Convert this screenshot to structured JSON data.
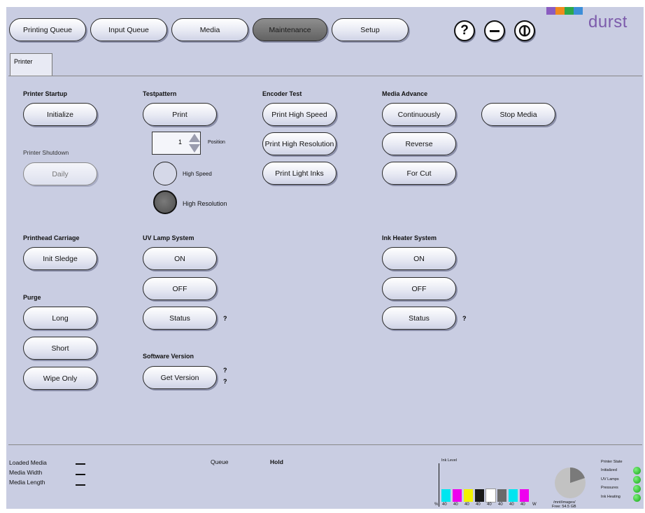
{
  "nav": {
    "printing_queue": "Printing Queue",
    "input_queue": "Input Queue",
    "media": "Media",
    "maintenance": "Maintenance",
    "setup": "Setup",
    "help": "?",
    "minimize": "−"
  },
  "brand": {
    "name": "durst",
    "bar_colors": [
      "#8a5cc0",
      "#f08a1c",
      "#2ca84a",
      "#3c8ed8"
    ]
  },
  "tab": {
    "label": "Printer"
  },
  "printer_startup": {
    "title": "Printer Startup",
    "initialize": "Initialize"
  },
  "printer_shutdown": {
    "title": "Printer Shutdown",
    "daily": "Daily"
  },
  "testpattern": {
    "title": "Testpattern",
    "print": "Print",
    "position_value": "1",
    "position_label": "Position",
    "high_speed": "High Speed",
    "high_resolution": "High Resolution"
  },
  "encoder_test": {
    "title": "Encoder Test",
    "print_high_speed": "Print High Speed",
    "print_high_resolution": "Print High Resolution",
    "print_light_inks": "Print Light Inks"
  },
  "media_advance": {
    "title": "Media Advance",
    "continuously": "Continuously",
    "reverse": "Reverse",
    "for_cut": "For Cut",
    "stop_media": "Stop Media"
  },
  "printhead_carriage": {
    "title": "Printhead Carriage",
    "init_sledge": "Init Sledge"
  },
  "purge": {
    "title": "Purge",
    "long": "Long",
    "short": "Short",
    "wipe_only": "Wipe Only"
  },
  "uv_lamp": {
    "title": "UV Lamp System",
    "on": "ON",
    "off": "OFF",
    "status": "Status",
    "status_q": "?"
  },
  "ink_heater": {
    "title": "Ink Heater System",
    "on": "ON",
    "off": "OFF",
    "status": "Status",
    "status_q": "?"
  },
  "software_version": {
    "title": "Software Version",
    "get_version": "Get Version",
    "q1": "?",
    "q2": "?"
  },
  "status_bar": {
    "loaded_media": "Loaded Media",
    "media_width": "Media Width",
    "media_length": "Media Length",
    "queue_label": "Queue",
    "queue_value": "Hold",
    "ink_level_label": "Ink Level",
    "ink_colors": [
      "#00e5f0",
      "#ee00ee",
      "#f2f200",
      "#1a1a1a",
      "#ffffff",
      "#6a6a6a",
      "#00e5f0",
      "#ee00ee"
    ],
    "ink_axis_unit": "%",
    "ink_values": [
      "40",
      "40",
      "40",
      "40",
      "40",
      "40",
      "40",
      "40"
    ],
    "ink_axis_end": "W",
    "disk_path": "/mnt/images/",
    "disk_free": "Free: 54.5 GB",
    "printer_state": "Printer State",
    "states": [
      "Initialized",
      "UV Lamps",
      "Pressures",
      "Ink Heating"
    ]
  }
}
